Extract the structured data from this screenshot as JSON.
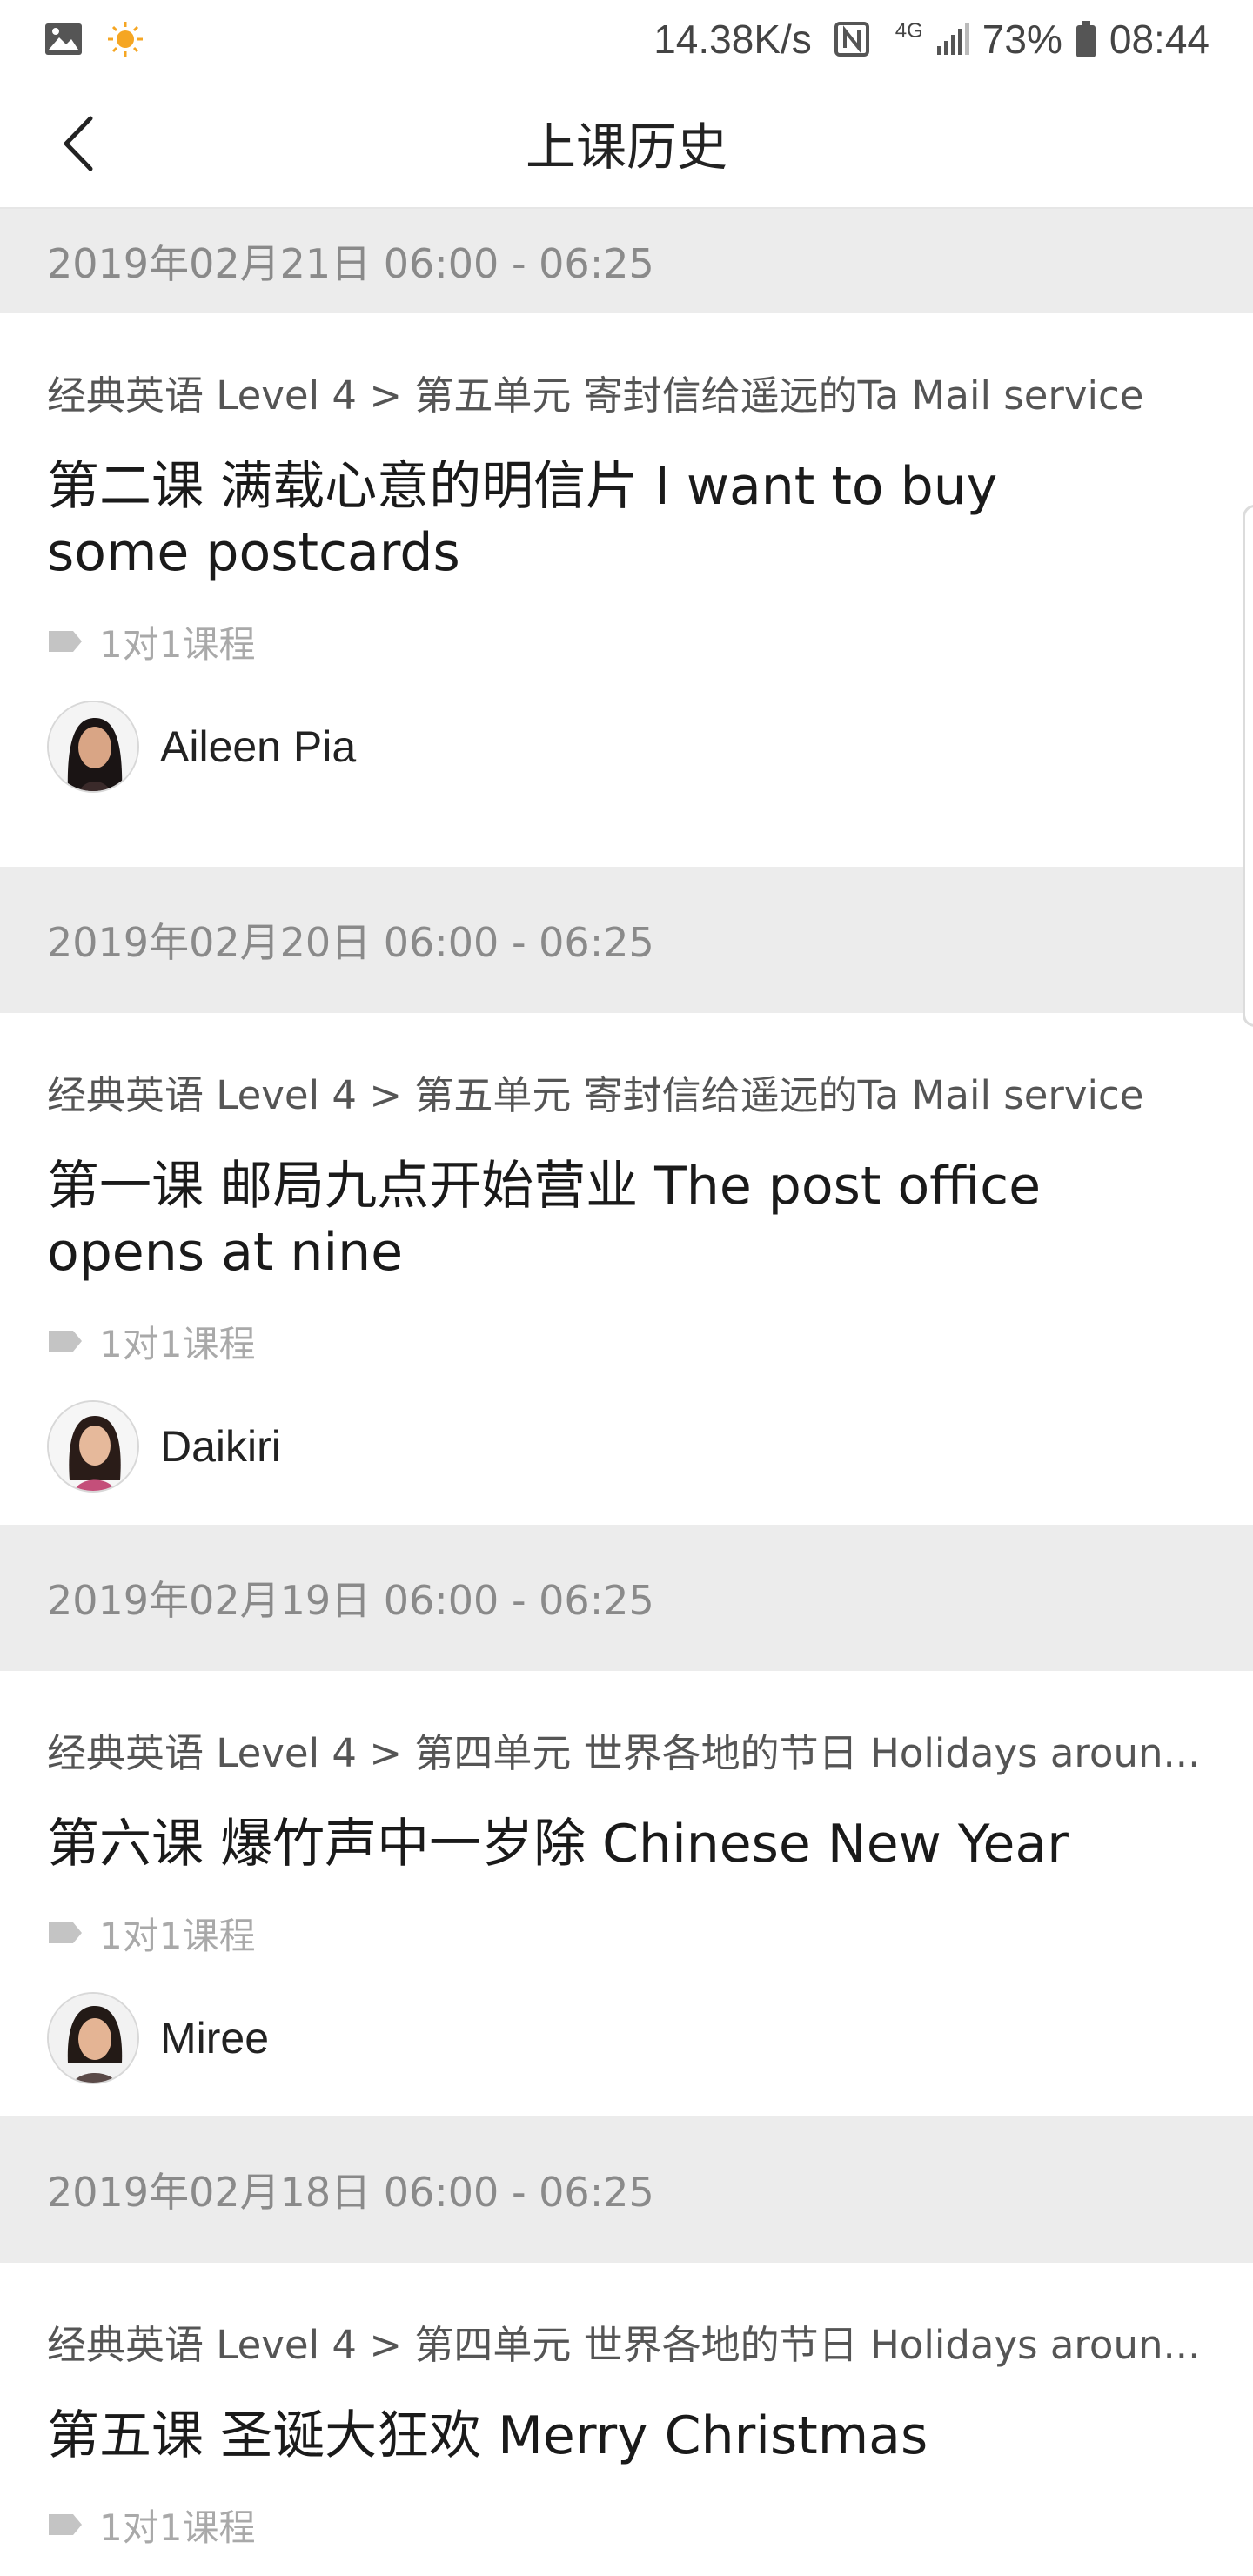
{
  "status_bar": {
    "speed": "14.38K/s",
    "network": "4G",
    "battery": "73%",
    "time": "08:44",
    "icons": [
      "gallery-icon",
      "sun-icon",
      "nfc-icon",
      "signal-icon",
      "battery-icon"
    ]
  },
  "header": {
    "title": "上课历史",
    "back_icon": "chevron-left-icon"
  },
  "records": [
    {
      "date": "2019年02月21日 06:00 - 06:25",
      "course": "经典英语 Level 4 > 第五单元 寄封信给遥远的Ta Mail service",
      "title": "第二课 满载心意的明信片 I want to buy some postcards",
      "tag": "1对1课程",
      "teacher": "Aileen Pia"
    },
    {
      "date": "2019年02月20日 06:00 - 06:25",
      "course": "经典英语 Level 4 > 第五单元 寄封信给遥远的Ta Mail service",
      "title": "第一课 邮局九点开始营业 The post office opens at nine",
      "tag": "1对1课程",
      "teacher": "Daikiri"
    },
    {
      "date": "2019年02月19日 06:00 - 06:25",
      "course": "经典英语 Level 4 > 第四单元 世界各地的节日 Holidays aroun...",
      "title": "第六课 爆竹声中一岁除 Chinese New Year",
      "tag": "1对1课程",
      "teacher": "Miree"
    },
    {
      "date": "2019年02月18日 06:00 - 06:25",
      "course": "经典英语 Level 4 > 第四单元 世界各地的节日 Holidays aroun...",
      "title": "第五课 圣诞大狂欢 Merry Christmas",
      "tag": "1对1课程",
      "teacher": ""
    }
  ]
}
